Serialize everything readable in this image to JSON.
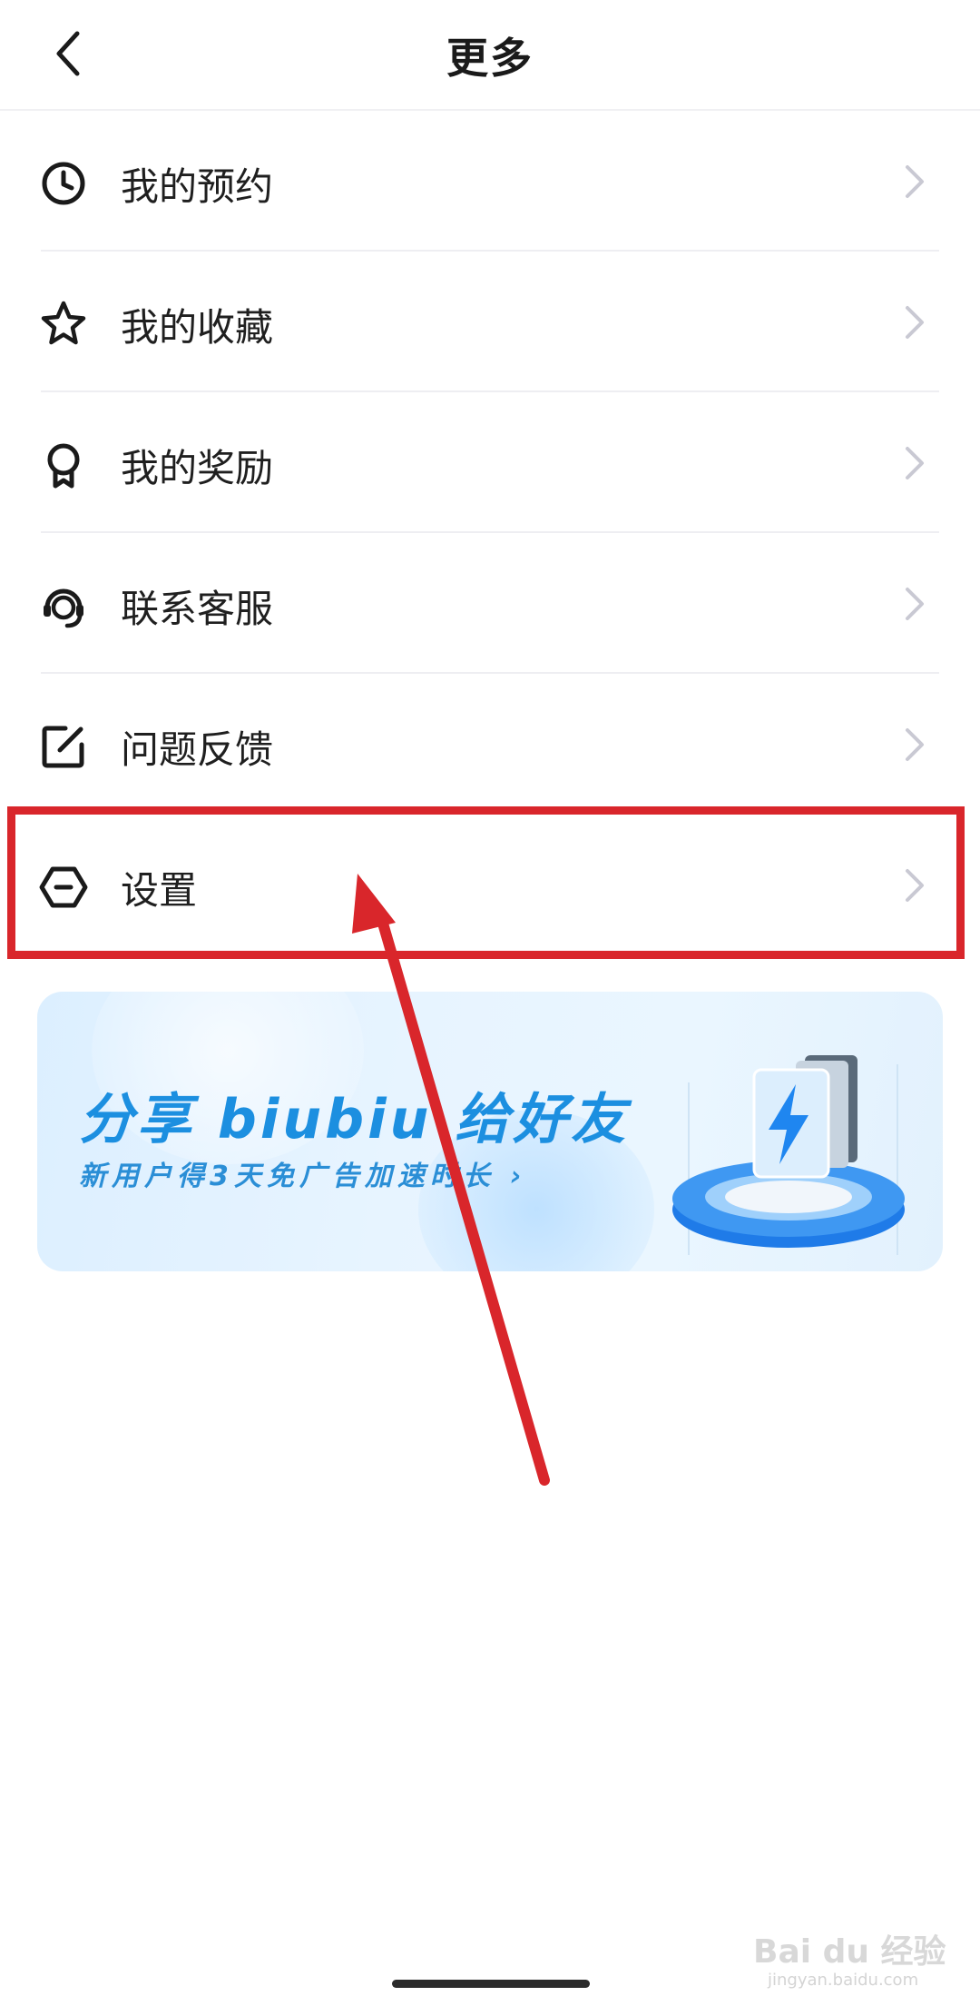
{
  "header": {
    "title": "更多"
  },
  "menu": {
    "items": [
      {
        "label": "我的预约",
        "icon": "clock-icon"
      },
      {
        "label": "我的收藏",
        "icon": "star-icon"
      },
      {
        "label": "我的奖励",
        "icon": "award-icon"
      },
      {
        "label": "联系客服",
        "icon": "headset-icon"
      },
      {
        "label": "问题反馈",
        "icon": "edit-icon"
      },
      {
        "label": "设置",
        "icon": "settings-hexagon-icon"
      }
    ]
  },
  "banner": {
    "title": "分享 biubiu 给好友",
    "subtitle": "新用户得3天免广告加速时长 ›"
  },
  "annotation": {
    "highlight_color": "#d9262b"
  },
  "watermark": {
    "brand": "Bai du 经验",
    "url": "jingyan.baidu.com"
  }
}
